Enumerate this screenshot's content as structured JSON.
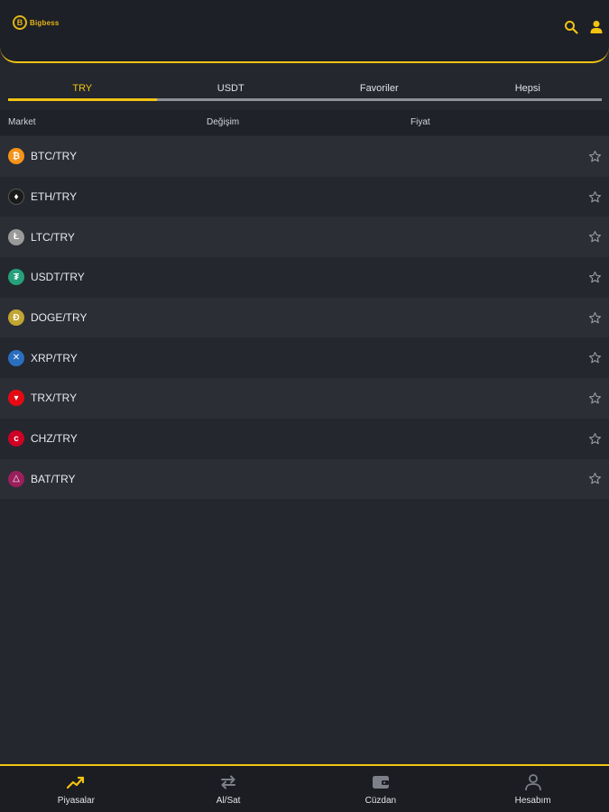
{
  "header": {
    "logo_text": "Bigbess",
    "logo_mark": "B",
    "icons": [
      "search-icon",
      "user-icon"
    ]
  },
  "tabs": [
    {
      "label": "TRY",
      "active": true
    },
    {
      "label": "USDT",
      "active": false
    },
    {
      "label": "Favoriler",
      "active": false
    },
    {
      "label": "Hepsi",
      "active": false
    }
  ],
  "columns": {
    "market": "Market",
    "change": "Değişim",
    "price": "Fiyat"
  },
  "markets": [
    {
      "pair": "BTC/TRY",
      "coin_glyph": "₿",
      "color": "#f7931a"
    },
    {
      "pair": "ETH/TRY",
      "coin_glyph": "♦",
      "color": "#1a1a1a"
    },
    {
      "pair": "LTC/TRY",
      "coin_glyph": "Ł",
      "color": "#9a9a9a"
    },
    {
      "pair": "USDT/TRY",
      "coin_glyph": "₮",
      "color": "#26a17b"
    },
    {
      "pair": "DOGE/TRY",
      "coin_glyph": "Ð",
      "color": "#c2a633"
    },
    {
      "pair": "XRP/TRY",
      "coin_glyph": "✕",
      "color": "#2a6fbf"
    },
    {
      "pair": "TRX/TRY",
      "coin_glyph": "▾",
      "color": "#e50914"
    },
    {
      "pair": "CHZ/TRY",
      "coin_glyph": "c",
      "color": "#cd0124"
    },
    {
      "pair": "BAT/TRY",
      "coin_glyph": "△",
      "color": "#9b1f5c"
    }
  ],
  "bottom_nav": [
    {
      "label": "Piyasalar",
      "icon": "trending-up-icon"
    },
    {
      "label": "Al/Sat",
      "icon": "swap-icon"
    },
    {
      "label": "Cüzdan",
      "icon": "wallet-icon"
    },
    {
      "label": "Hesabım",
      "icon": "account-icon"
    }
  ],
  "colors": {
    "accent": "#f2c312",
    "background": "#24272e"
  }
}
